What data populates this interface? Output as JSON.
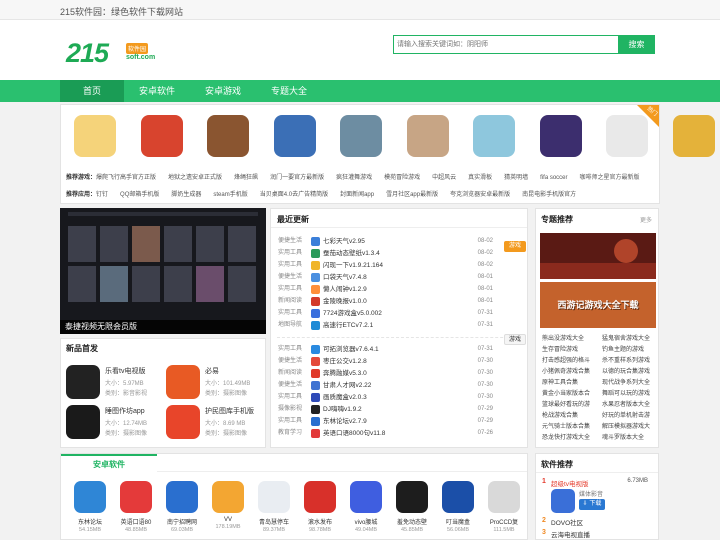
{
  "topbar": {
    "text": "215软件园：绿色软件下载网站"
  },
  "logo": {
    "main": "215",
    "badge": "软件园",
    "domain": "soft.com"
  },
  "search": {
    "placeholder": "请输入搜索关键词如：阴阳师",
    "button": "搜索"
  },
  "nav": [
    {
      "label": "首页",
      "active": true
    },
    {
      "label": "安卓软件",
      "active": false
    },
    {
      "label": "安卓游戏",
      "active": false
    },
    {
      "label": "专题大全",
      "active": false
    }
  ],
  "featured": {
    "hot_badge": "热门",
    "app_colors": [
      "#f5d37a",
      "#d8442e",
      "#8a5530",
      "#3b6fb6",
      "#6d8da2",
      "#c7a585",
      "#8ec7dd",
      "#3c2e6e",
      "#e9e9e9",
      "#e4b23a"
    ],
    "rec_game_label": "推荐游戏：",
    "rec_games": [
      "爆爬飞行高手官方正版",
      "地狱之遗安卓正式版",
      "烽绳狂飙",
      "润门一要官方最新版",
      "疯狂灌舞游戏",
      "模苑冒险游戏",
      "中超风云",
      "真实滑板",
      "猜英明墙",
      "fifa soccer",
      "咖啡师之星官方最新版"
    ],
    "rec_app_label": "推荐应用：",
    "rec_apps": [
      "钉钉",
      "QQ邮箱手机版",
      "脚奶生成器",
      "steam手机版",
      "当贝桌面4.0去广告精简版",
      "封面新闻app",
      "雪月社区app最新版",
      "夸克浏览器安卓最新版",
      "南昆电影手机版官方"
    ]
  },
  "promo": {
    "caption": "泰捷视频无限会员版"
  },
  "new_release": {
    "title": "新品首发",
    "items": [
      {
        "name": "乐看tv电视版",
        "size": "大小：5.97MB",
        "type": "类别：影音影视",
        "color": "#222"
      },
      {
        "name": "必易",
        "size": "大小：101.49MB",
        "type": "类别：摄影图像",
        "color": "#e85a24"
      },
      {
        "name": "睡图作坊app",
        "size": "大小：12.74MB",
        "type": "类别：摄影图像",
        "color": "#1a1a1a"
      },
      {
        "name": "护民图库手机版",
        "size": "大小：8.69 MB",
        "type": "类别：摄影图像",
        "color": "#e8452a"
      }
    ]
  },
  "recent": {
    "title": "最近更新",
    "group1_tag": "游戏",
    "group2_tag": "游戏",
    "group1": [
      {
        "cat": "便捷生活",
        "name": "七彩天气v2.95",
        "date": "08-02",
        "color": "#3b7fd9"
      },
      {
        "cat": "实用工具",
        "name": "蚕茄动态壁纸v1.3.4",
        "date": "08-02",
        "color": "#2a9a5a"
      },
      {
        "cat": "实用工具",
        "name": "闪现一下v1.9.21.164",
        "date": "08-02",
        "color": "#f0b52a"
      },
      {
        "cat": "便捷生活",
        "name": "口袋天气v7.4.8",
        "date": "08-01",
        "color": "#4a8fe0"
      },
      {
        "cat": "实用工具",
        "name": "懒人闹钟v1.2.9",
        "date": "08-01",
        "color": "#ff8f3a"
      },
      {
        "cat": "新闻阅读",
        "name": "金陵晚报v1.0.0",
        "date": "08-01",
        "color": "#d33a2a"
      },
      {
        "cat": "实用工具",
        "name": "7724游戏盒v5.0.002",
        "date": "07-31",
        "color": "#3a6fdd"
      },
      {
        "cat": "地图导航",
        "name": "高速行ETCv7.2.1",
        "date": "07-31",
        "color": "#1e8ad6"
      }
    ],
    "group2": [
      {
        "cat": "实用工具",
        "name": "可拓浏览器v7.6.4.1",
        "date": "07-31",
        "color": "#2a8ae0"
      },
      {
        "cat": "便捷生活",
        "name": "枣庄公交v1.2.8",
        "date": "07-30",
        "color": "#e44a3a"
      },
      {
        "cat": "新闻阅读",
        "name": "奔腾融媒v5.3.0",
        "date": "07-30",
        "color": "#e03a2a"
      },
      {
        "cat": "便捷生活",
        "name": "甘肃人才网v2.22",
        "date": "07-30",
        "color": "#3f73d2"
      },
      {
        "cat": "实用工具",
        "name": "画质魔盒v2.0.3",
        "date": "07-30",
        "color": "#2f4bb8"
      },
      {
        "cat": "摄像影视",
        "name": "DJ嗨嗨v1.9.2",
        "date": "07-29",
        "color": "#222"
      },
      {
        "cat": "实用工具",
        "name": "东林论坛v2.7.9",
        "date": "07-29",
        "color": "#2a6fcf"
      },
      {
        "cat": "教育学习",
        "name": "英语口语8000句v11.8",
        "date": "07-26",
        "color": "#e23a3a"
      }
    ]
  },
  "topics": {
    "title": "专题推荐",
    "more": "更多",
    "banner2_text": "西游记游戏大全下载",
    "list": [
      "熊出没游戏大全",
      "猛鬼宿舍游戏大全",
      "生存冒险游戏",
      "钓鱼主题的游戏",
      "打击感超强的格斗",
      "杀不重样系列游戏",
      "小猪佩奇游戏合集",
      "以德的玩合集游戏",
      "原神工具合集",
      "现代战争系列大全",
      "黄金小当家版本合",
      "舞蹈可以玩的游戏",
      "篮球最好看玩的游",
      "水果忍者版本大全",
      "枪战游戏合集",
      "好玩的单机射击游",
      "元气骑士版本合集",
      "解压模拟器游戏大",
      "恐龙快打游戏大全",
      "魂斗罗版本大全"
    ]
  },
  "android_soft": {
    "tab": "安卓软件",
    "items": [
      {
        "name": "东林论坛",
        "size": "54.15MB",
        "color": "#2f86d6"
      },
      {
        "name": "英语口语80",
        "size": "48.85MB",
        "color": "#e43a3a"
      },
      {
        "name": "南宁招聘网",
        "size": "69.03MB",
        "color": "#2a6fcf"
      },
      {
        "name": "VV",
        "size": "178.19MB",
        "color": "#f3a632"
      },
      {
        "name": "青岛慧停车",
        "size": "89.37MB",
        "color": "#e9edf2"
      },
      {
        "name": "滚水发布",
        "size": "98.78MB",
        "color": "#d8302a"
      },
      {
        "name": "vivo腰城",
        "size": "49.04MB",
        "color": "#3f5ee0"
      },
      {
        "name": "羞免动态壁",
        "size": "45.85MB",
        "color": "#1d1d1d"
      },
      {
        "name": "叮当魔盒",
        "size": "56.06MB",
        "color": "#1b4fa8"
      },
      {
        "name": "ProCCD复",
        "size": "111.5MB",
        "color": "#d9d9d9"
      }
    ]
  },
  "soft_rec": {
    "title": "软件推荐",
    "top": {
      "rank": "1",
      "name": "超级tv电视版",
      "size": "6.73MB",
      "type": "媒体影音",
      "button": "下载"
    },
    "list": [
      {
        "rank": "2",
        "name": "DOVO社区"
      },
      {
        "rank": "3",
        "name": "云海电视直播"
      }
    ]
  }
}
